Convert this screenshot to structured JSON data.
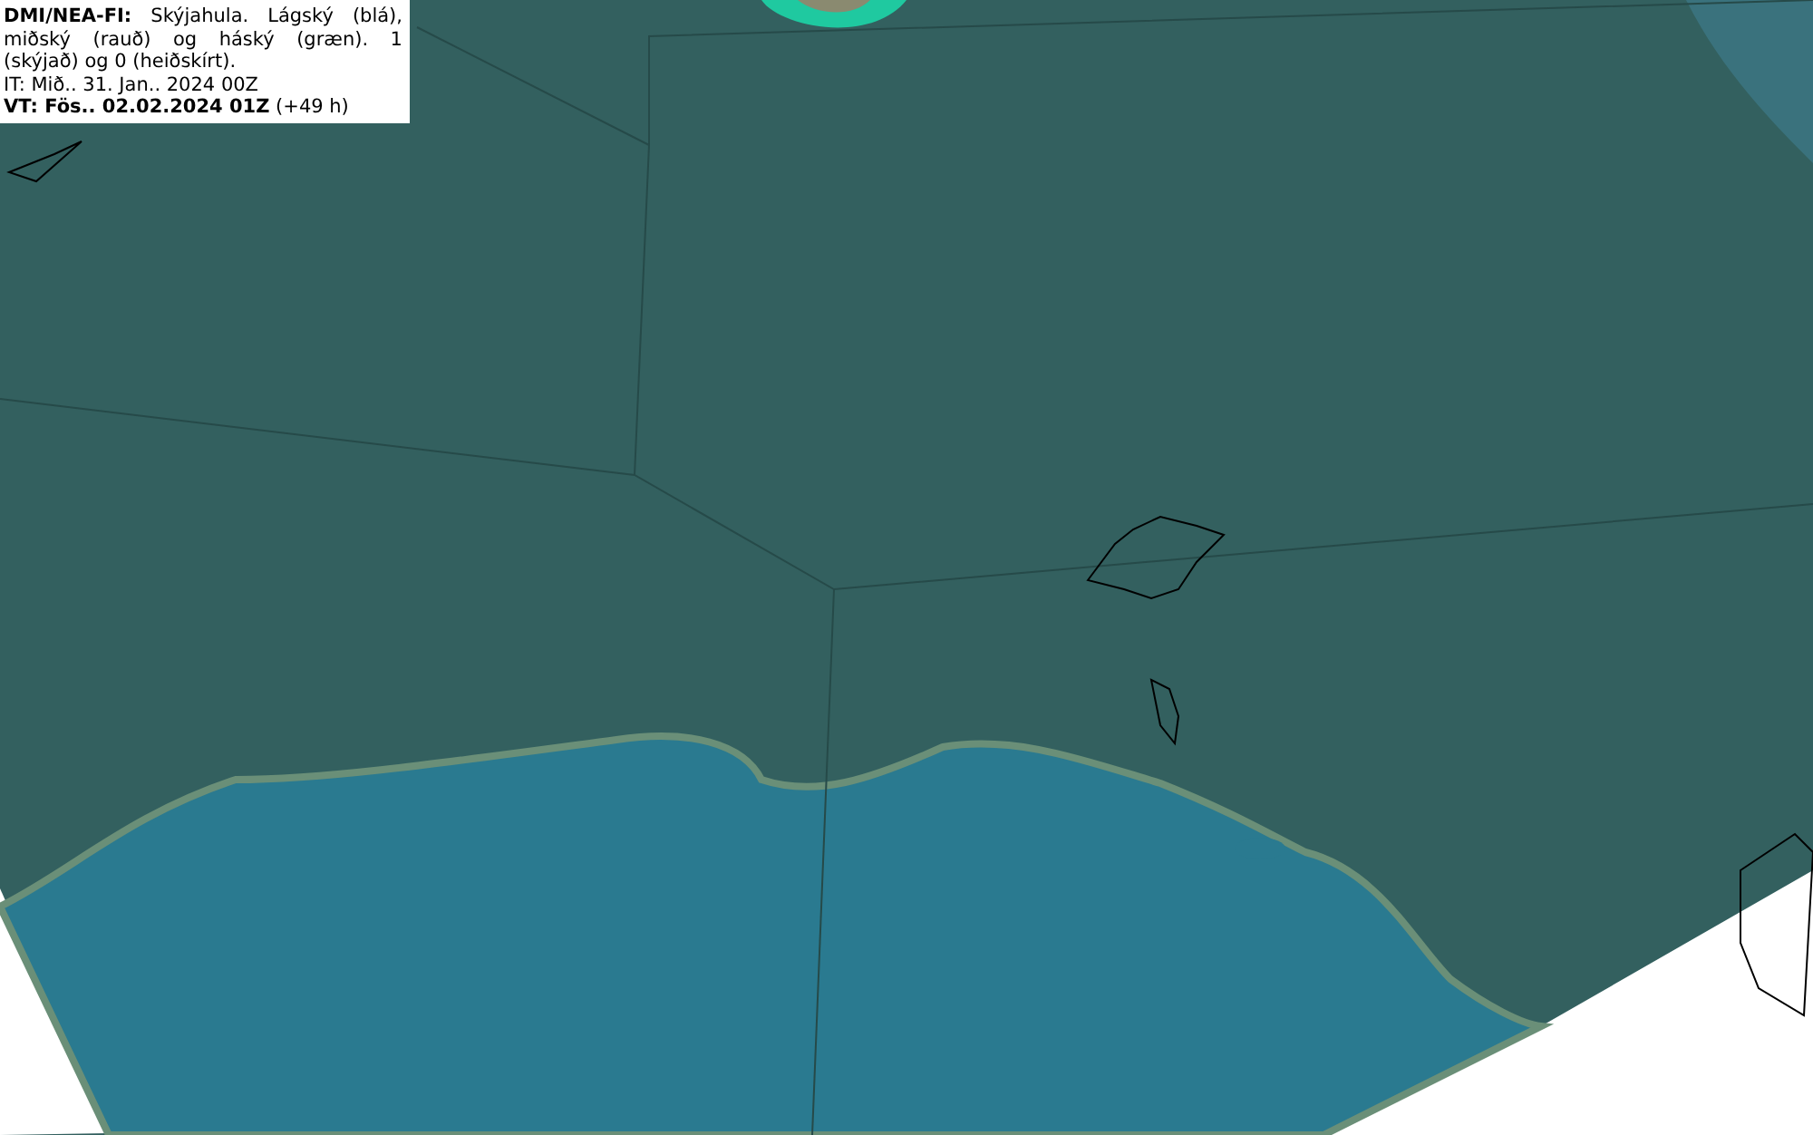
{
  "legend": {
    "description": "**DMI/NEA-FI:** Skýjahula. Lágský (blá), miðský (rauð) og háský (græn). 1 (skýjað) og 0 (heiðskírt).",
    "init_time": "IT: Mið.. 31. Jan.. 2024 00Z",
    "valid_time": "**VT: Fös.. 02.02.2024 01Z** (+49 h)"
  }
}
